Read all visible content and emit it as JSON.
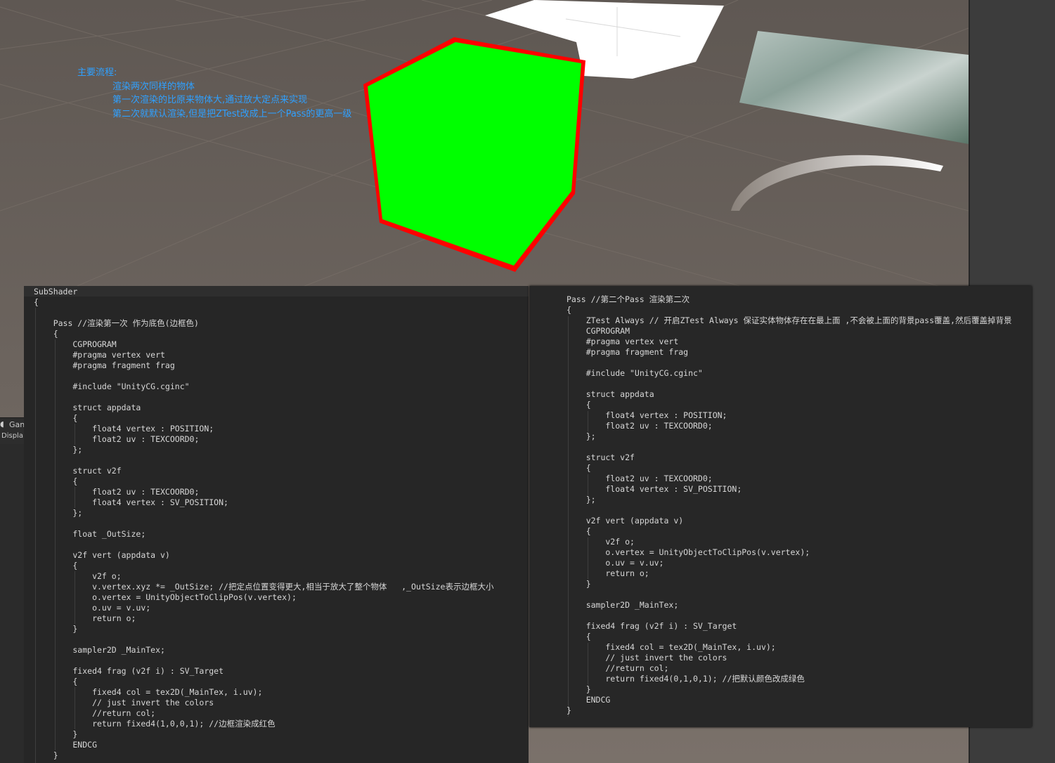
{
  "notes": {
    "title": "主要流程:",
    "lines": [
      "渲染两次同样的物体",
      "第一次渲染的比原来物体大,通过放大定点来实现",
      "第二次就默认渲染,但是把ZTest改成上一个Pass的更高一级"
    ]
  },
  "left_panel": {
    "tab_label": "Gan",
    "tab_sub": "Displa"
  },
  "colors": {
    "cube_face": "#00ff00",
    "outline": "#ff0000",
    "note_text": "#2fa0ff",
    "editor_bg": "#262626"
  },
  "code_left": [
    "SubShader",
    "{",
    "",
    "    Pass //渲染第一次 作为底色(边框色)",
    "    {",
    "        CGPROGRAM",
    "        #pragma vertex vert",
    "        #pragma fragment frag",
    "",
    "        #include \"UnityCG.cginc\"",
    "",
    "        struct appdata",
    "        {",
    "            float4 vertex : POSITION;",
    "            float2 uv : TEXCOORD0;",
    "        };",
    "",
    "        struct v2f",
    "        {",
    "            float2 uv : TEXCOORD0;",
    "            float4 vertex : SV_POSITION;",
    "        };",
    "",
    "        float _OutSize;",
    "",
    "        v2f vert (appdata v)",
    "        {",
    "            v2f o;",
    "            v.vertex.xyz *= _OutSize; //把定点位置变得更大,相当于放大了整个物体   ,_OutSize表示边框大小",
    "            o.vertex = UnityObjectToClipPos(v.vertex);",
    "            o.uv = v.uv;",
    "            return o;",
    "        }",
    "",
    "        sampler2D _MainTex;",
    "",
    "        fixed4 frag (v2f i) : SV_Target",
    "        {",
    "            fixed4 col = tex2D(_MainTex, i.uv);",
    "            // just invert the colors",
    "            //return col;",
    "            return fixed4(1,0,0,1); //边框渲染成红色",
    "        }",
    "        ENDCG",
    "    }"
  ],
  "code_right": [
    "Pass //第二个Pass 渲染第二次",
    "{",
    "    ZTest Always // 开启ZTest Always 保证实体物体存在在最上面 ,不会被上面的背景pass覆盖,然后覆盖掉背景",
    "    CGPROGRAM",
    "    #pragma vertex vert",
    "    #pragma fragment frag",
    "",
    "    #include \"UnityCG.cginc\"",
    "",
    "    struct appdata",
    "    {",
    "        float4 vertex : POSITION;",
    "        float2 uv : TEXCOORD0;",
    "    };",
    "",
    "    struct v2f",
    "    {",
    "        float2 uv : TEXCOORD0;",
    "        float4 vertex : SV_POSITION;",
    "    };",
    "",
    "    v2f vert (appdata v)",
    "    {",
    "        v2f o;",
    "        o.vertex = UnityObjectToClipPos(v.vertex);",
    "        o.uv = v.uv;",
    "        return o;",
    "    }",
    "",
    "    sampler2D _MainTex;",
    "",
    "    fixed4 frag (v2f i) : SV_Target",
    "    {",
    "        fixed4 col = tex2D(_MainTex, i.uv);",
    "        // just invert the colors",
    "        //return col;",
    "        return fixed4(0,1,0,1); //把默认颜色改成绿色",
    "    }",
    "    ENDCG",
    "}"
  ]
}
